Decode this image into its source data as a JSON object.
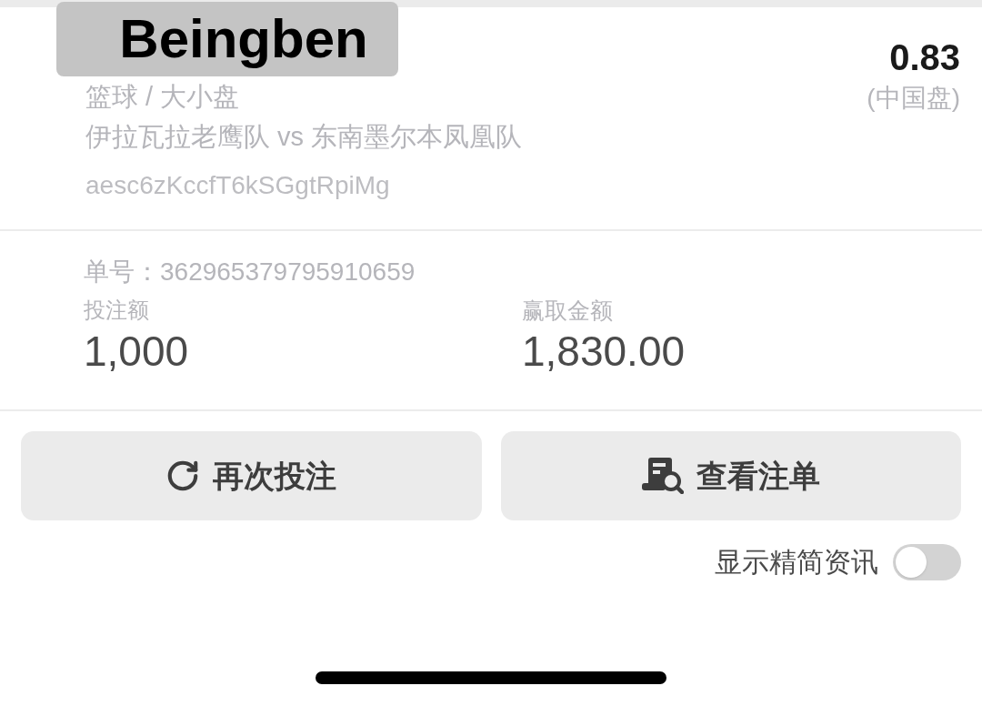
{
  "overlay_label": {
    "text": "Beingben"
  },
  "bet": {
    "sport_market": "篮球 / 大小盘",
    "match": "伊拉瓦拉老鹰队 vs 东南墨尔本凤凰队",
    "selection_id": "aesc6zKccfT6kSGgtRpiMg",
    "odds": "0.83",
    "odds_type": "(中国盘)"
  },
  "ticket": {
    "order_number": "单号：362965379795910659",
    "stake": {
      "label": "投注额",
      "value": "1,000"
    },
    "payout": {
      "label": "赢取金额",
      "value": "1,830.00"
    }
  },
  "buttons": [
    {
      "kind": "rebet",
      "label": "再次投注"
    },
    {
      "kind": "view_slip",
      "label": "查看注单"
    }
  ],
  "toggle": {
    "label": "显示精简资讯",
    "on": false
  }
}
